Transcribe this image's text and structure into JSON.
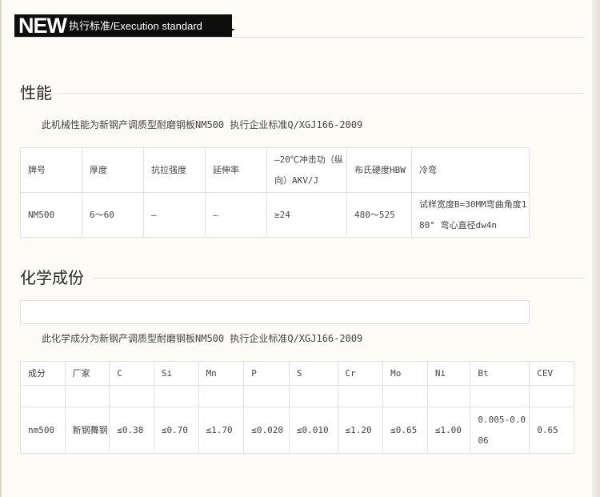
{
  "banner": {
    "new_label": "NEW",
    "subtitle": "执行标准/Execution standard"
  },
  "performance": {
    "title": "性能",
    "note": "此机械性能为新钢产调质型耐磨钢板NM500 执行企业标准Q/XGJ166-2009",
    "headers": [
      "牌号",
      "厚度",
      "抗拉强度",
      "延伸率",
      "—20℃冲击功（纵向）AKV/J",
      "布氏硬度HBW",
      "冷弯"
    ],
    "row": [
      "NM500",
      "6～60",
      "—",
      "—",
      "≥24",
      "480～525",
      "试样宽度B=30MM弯曲角度180° 弯心直径dw4n"
    ]
  },
  "chemistry": {
    "title": "化学成份",
    "note": "此化学成分为新钢产调质型耐磨钢板NM500 执行企业标准Q/XGJ166-2009",
    "headers": [
      "成分",
      "厂家",
      "C",
      "Si",
      "Mn",
      "P",
      "S",
      "Cr",
      "Mo",
      "Ni",
      "Bt",
      "CEV"
    ],
    "row": [
      "nm500",
      "新钢舞钢",
      "≤0.38",
      "≤0.70",
      "≤1.70",
      "≤0.020",
      "≤0.010",
      "≤1.20",
      "≤0.65",
      "≤1.00",
      "0.005-0.006",
      "0.65"
    ]
  }
}
